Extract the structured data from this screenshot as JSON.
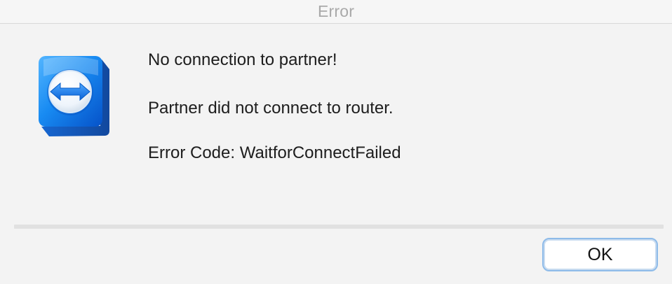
{
  "window": {
    "title": "Error"
  },
  "dialog": {
    "icon": "teamviewer-logo-icon",
    "message_heading": "No connection to partner!",
    "message_detail": "Partner did not connect to router.",
    "error_code": "Error Code: WaitforConnectFailed",
    "ok_label": "OK"
  },
  "colors": {
    "icon_blue": "#1476e8",
    "button_focus_ring": "#8ebbe9"
  }
}
